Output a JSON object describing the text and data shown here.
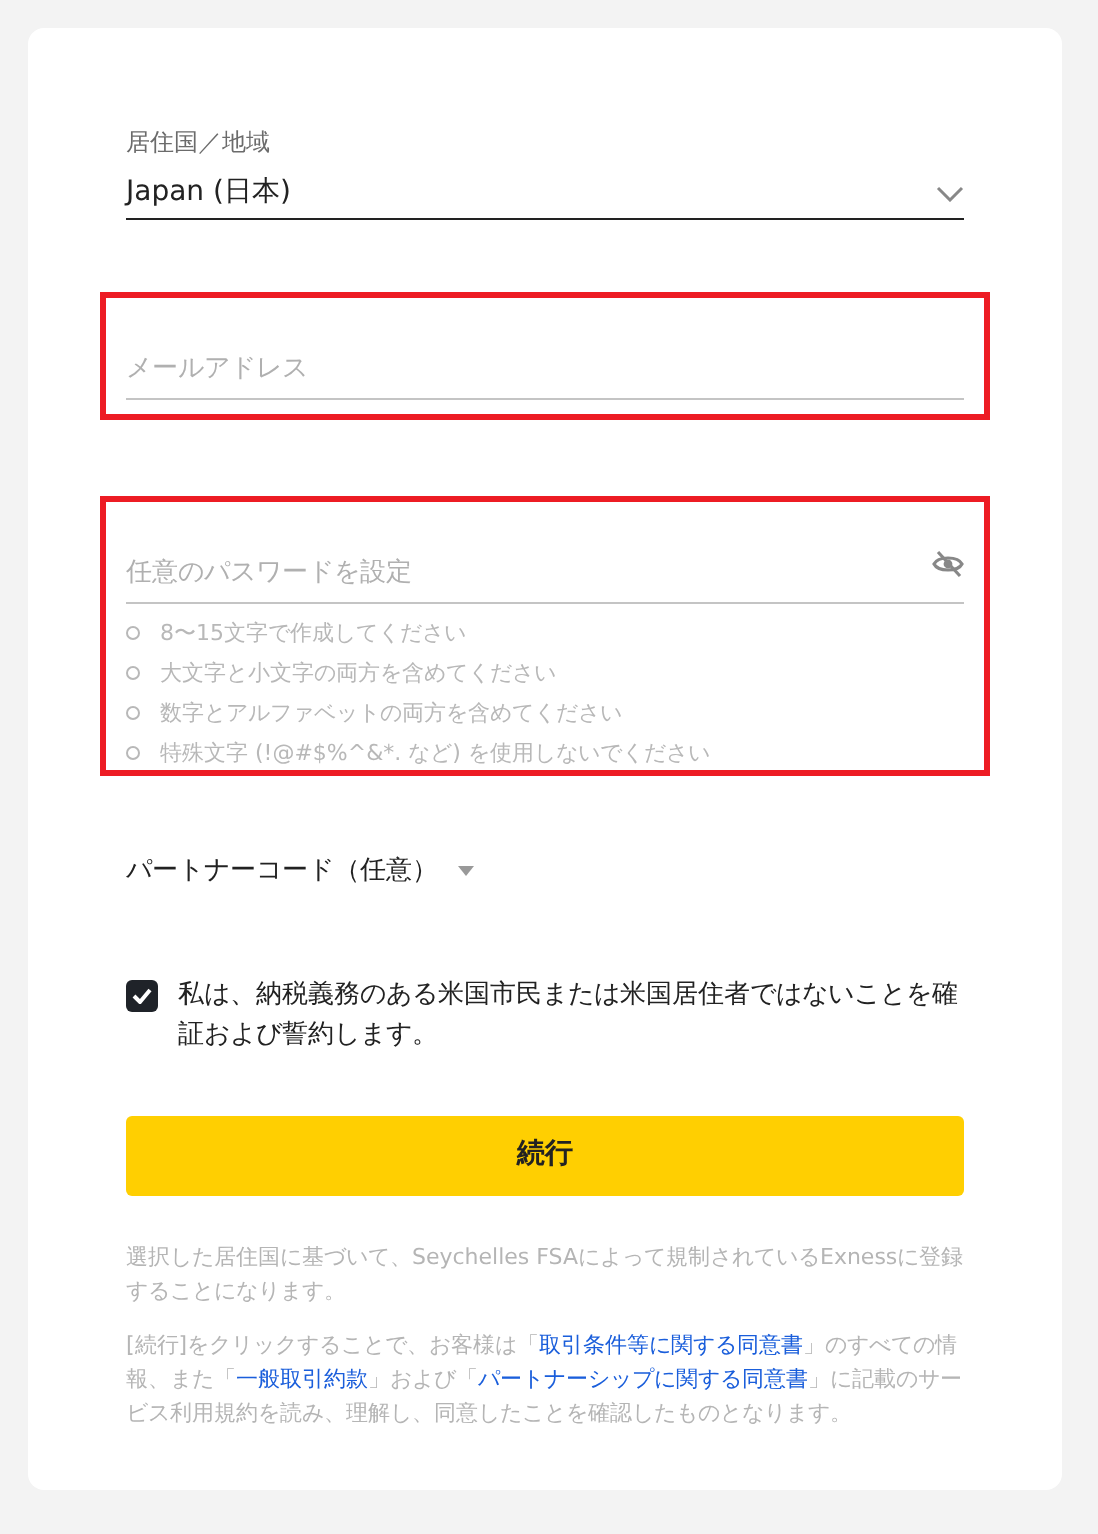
{
  "country": {
    "label": "居住国／地域",
    "value": "Japan (日本)"
  },
  "email": {
    "placeholder": "メールアドレス",
    "highlighted": true
  },
  "password": {
    "placeholder": "任意のパスワードを設定",
    "highlighted": true,
    "rules": [
      {
        "text": "8〜15文字で作成してください"
      },
      {
        "text": "大文字と小文字の両方を含めてください"
      },
      {
        "text": "数字とアルファベットの両方を含めてください"
      },
      {
        "text": "特殊文字 (!@#$%^&*. など) を使用しないでください"
      }
    ]
  },
  "partner_code": {
    "label": "パートナーコード（任意）"
  },
  "declaration": {
    "checked": true,
    "text": "私は、納税義務のある米国市民または米国居住者ではないことを確証および誓約します。"
  },
  "submit": {
    "label": "続行"
  },
  "notice": "選択した居住国に基づいて、Seychelles FSAによって規制されているExnessに登録することになります。",
  "terms": [
    {
      "kind": "text",
      "text": "[続行]をクリックすることで、お客様は「"
    },
    {
      "kind": "link",
      "text": "取引条件等に関する同意書"
    },
    {
      "kind": "text",
      "text": "」のすべての情報、また「"
    },
    {
      "kind": "link",
      "text": "一般取引約款"
    },
    {
      "kind": "text",
      "text": "」および「"
    },
    {
      "kind": "link",
      "text": "パートナーシップに関する同意書"
    },
    {
      "kind": "text",
      "text": "」に記載のサービス利用規約を読み、理解し、同意したことを確認したものとなります。"
    }
  ]
}
